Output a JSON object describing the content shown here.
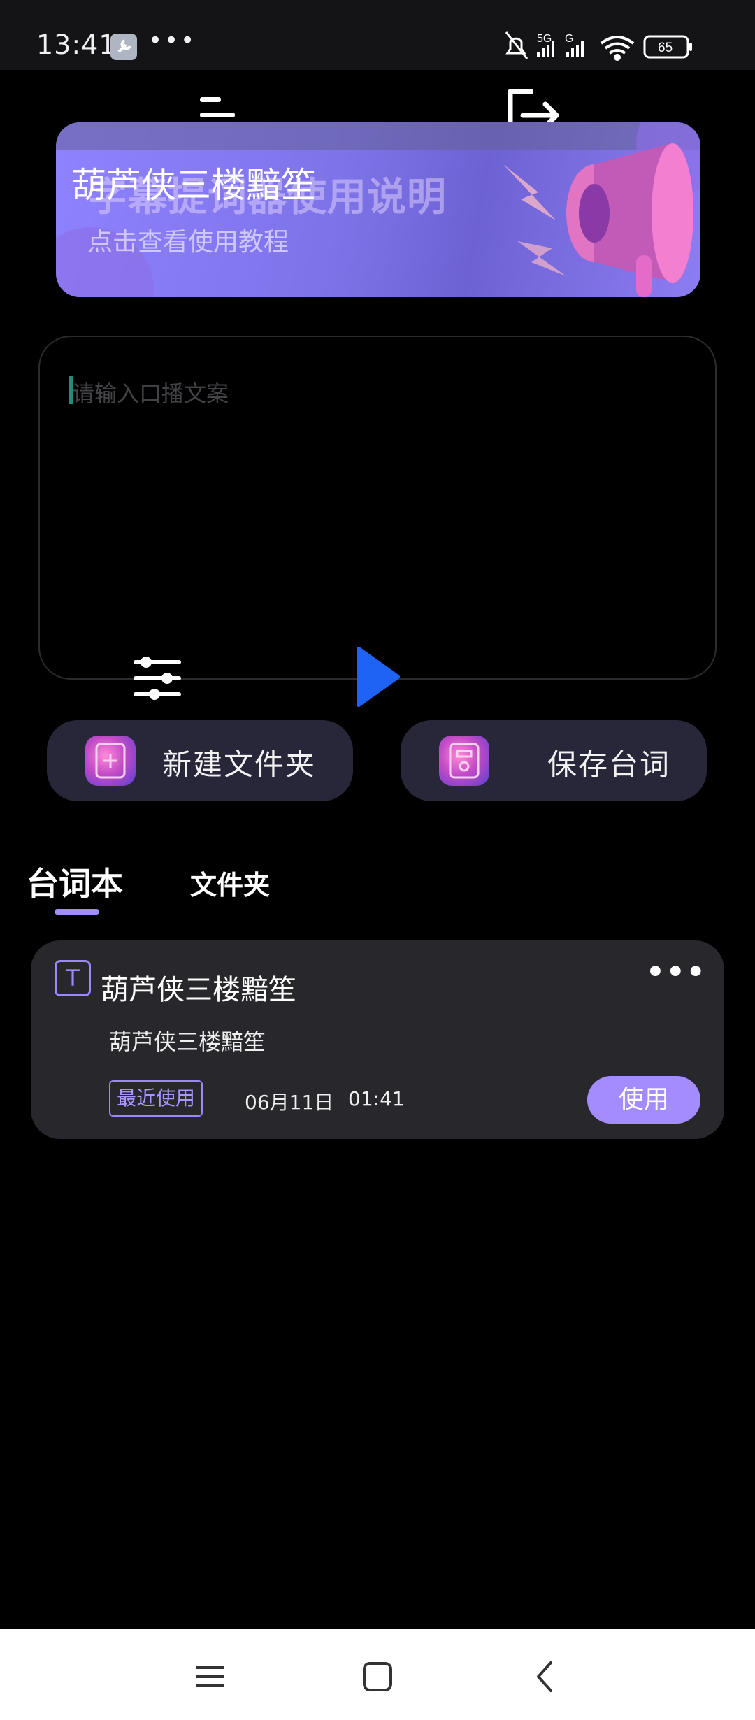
{
  "status_bar": {
    "time": "13:41",
    "dots": "•••",
    "battery": "65",
    "network": "5G",
    "network2": "G"
  },
  "banner": {
    "overlay_title": "葫芦侠三楼黯笙",
    "watermark": "字幕提词器使用说明",
    "subtitle": "点击查看使用教程"
  },
  "editor": {
    "placeholder": "请输入口播文案"
  },
  "actions": {
    "new_folder": "新建文件夹",
    "save_script": "保存台词"
  },
  "tabs": {
    "active": "台词本",
    "inactive": "文件夹"
  },
  "card": {
    "icon_letter": "T",
    "title": "葫芦侠三楼黯笙",
    "subtitle": "葫芦侠三楼黯笙",
    "badge": "最近使用",
    "date": "06月11日",
    "time": "01:41",
    "more": "•••",
    "use_button": "使用"
  },
  "colors": {
    "accent": "#a48cff",
    "play": "#1f63f4",
    "background": "#000000",
    "card": "#28272b"
  }
}
